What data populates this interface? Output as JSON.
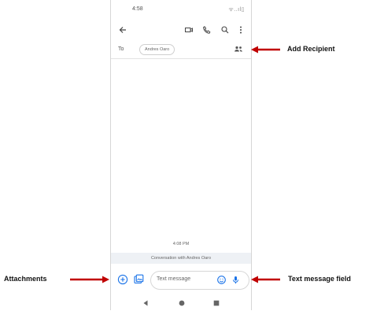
{
  "status_bar": {
    "time": "4:58",
    "icons_text": "ᯤ..ıl▯"
  },
  "toolbar": {
    "back_icon": "arrow-left-icon",
    "video_icon": "video-camera-icon",
    "call_icon": "phone-icon",
    "search_icon": "search-icon",
    "more_icon": "more-vert-icon"
  },
  "recipient_row": {
    "to_label": "To",
    "chip_text": "Andres Oaro",
    "add_icon": "add-recipient-icon"
  },
  "conversation": {
    "timestamp": "4:08 PM",
    "banner": "Conversation with Andres Oaro"
  },
  "compose": {
    "placeholder": "Text message",
    "add_icon": "plus-circle-icon",
    "gallery_icon": "gallery-icon",
    "emoji_icon": "emoji-icon",
    "mic_icon": "mic-icon"
  },
  "navbar": {
    "back_icon": "nav-back-icon",
    "home_icon": "nav-home-icon",
    "recents_icon": "nav-recents-icon"
  },
  "annotations": {
    "add_recipient": "Add Recipient",
    "attachments": "Attachments",
    "text_message_field": "Text message field",
    "arrow_color": "#c00000"
  }
}
